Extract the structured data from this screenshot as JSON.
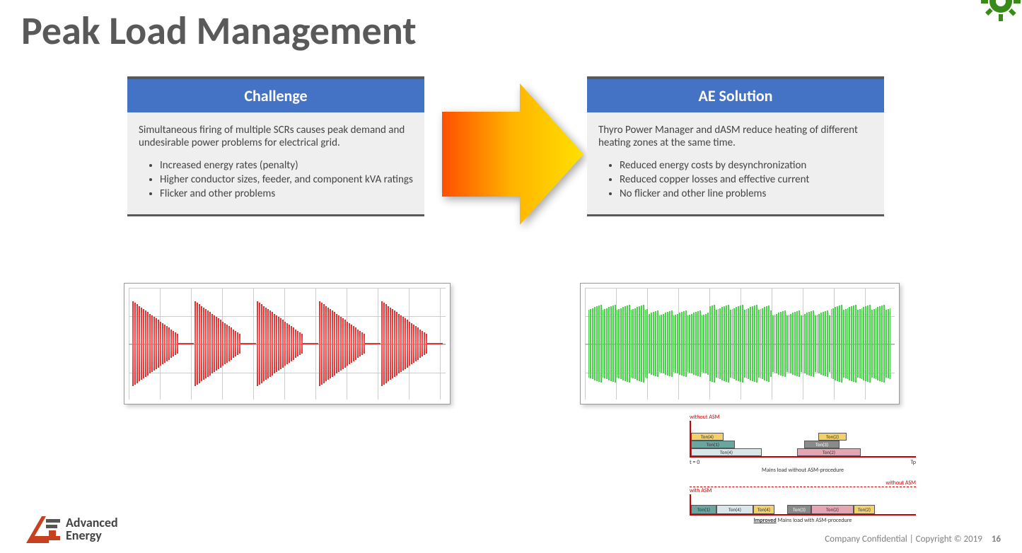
{
  "title": "Peak Load Management",
  "challenge": {
    "header": "Challenge",
    "intro": "Simultaneous firing of multiple SCRs causes peak demand and undesirable power problems for electrical grid.",
    "bullets": [
      "Increased energy rates (penalty)",
      "Higher conductor sizes, feeder, and component kVA ratings",
      "Flicker and other problems"
    ]
  },
  "solution": {
    "header": "AE Solution",
    "intro": "Thyro Power Manager and dASM reduce heating of different heating zones at the same time.",
    "bullets": [
      "Reduced energy costs by desynchronization",
      "Reduced copper losses and effective current",
      "No flicker and other line problems"
    ]
  },
  "diagram": {
    "without_label": "without ASM",
    "with_label": "with ASM",
    "caption1": "Mains load without ASM-procedure",
    "caption2_prefix": "Improved",
    "caption2_rest": " Mains load with ASM-procedure",
    "t0": "t = 0",
    "tp": "Tp",
    "blocks": [
      "Ton(4)",
      "Ton(1)",
      "Ton(4)",
      "Ton(2)",
      "Ton(3)",
      "Ton(2)"
    ]
  },
  "footer": {
    "text": "Company Confidential | Copyright © 2019",
    "page": "16"
  },
  "logo": {
    "line1": "Advanced",
    "line2": "Energy"
  }
}
